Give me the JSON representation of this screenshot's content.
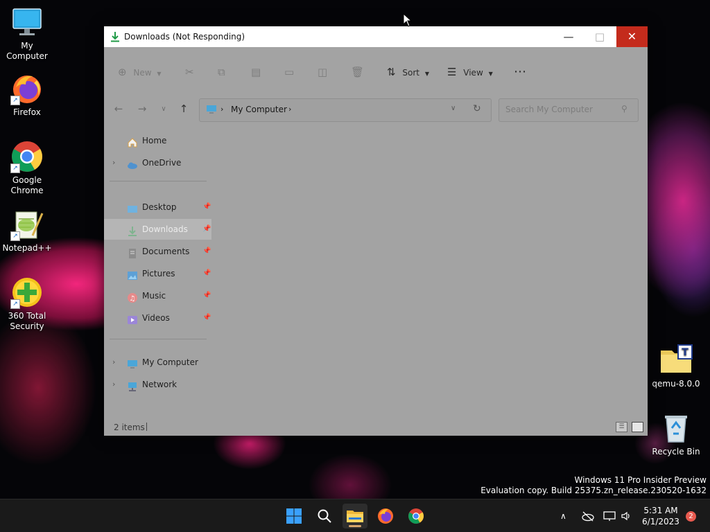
{
  "desktop": {
    "icons": [
      {
        "label": "My Computer"
      },
      {
        "label": "Firefox"
      },
      {
        "label": "Google Chrome"
      },
      {
        "label": "Notepad++"
      },
      {
        "label": "360 Total Security"
      },
      {
        "label": "qemu-8.0.0"
      },
      {
        "label": "Recycle Bin"
      }
    ]
  },
  "window": {
    "title": "Downloads (Not Responding)",
    "toolbar": {
      "new": "New",
      "sort": "Sort",
      "view": "View"
    },
    "address": {
      "location": "My Computer"
    },
    "search": {
      "placeholder": "Search My Computer"
    },
    "nav": {
      "home": "Home",
      "onedrive": "OneDrive",
      "desktop": "Desktop",
      "downloads": "Downloads",
      "documents": "Documents",
      "pictures": "Pictures",
      "music": "Music",
      "videos": "Videos",
      "mycomputer": "My Computer",
      "network": "Network"
    },
    "status": {
      "items": "2 items"
    }
  },
  "watermark": {
    "line1": "Windows 11 Pro Insider Preview",
    "line2": "Evaluation copy. Build 25375.zn_release.230520-1632"
  },
  "taskbar": {
    "time": "5:31 AM",
    "date": "6/1/2023",
    "notifications": "2"
  },
  "colors": {
    "close_button": "#c42b1c",
    "active_indicator": "#d7a56b"
  }
}
